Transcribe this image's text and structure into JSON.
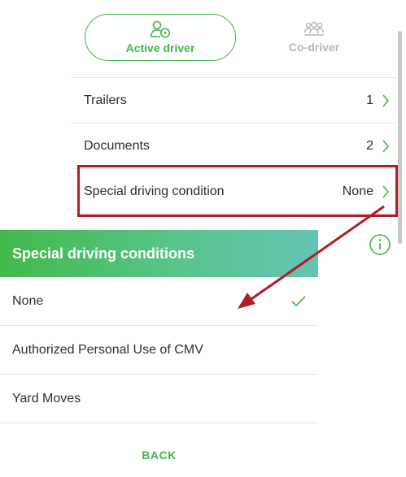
{
  "driver_toggle": {
    "active_label": "Active driver",
    "inactive_label": "Co-driver",
    "active_icon": "active-driver-icon",
    "inactive_icon": "co-driver-icon"
  },
  "settings_list": {
    "rows": [
      {
        "label": "Trailers",
        "value": "1"
      },
      {
        "label": "Documents",
        "value": "2"
      },
      {
        "label": "Special driving condition",
        "value": "None"
      }
    ]
  },
  "dialog": {
    "title": "Special driving conditions",
    "options": [
      {
        "label": "None",
        "selected": true
      },
      {
        "label": "Authorized Personal Use of CMV",
        "selected": false
      },
      {
        "label": "Yard Moves",
        "selected": false
      }
    ],
    "back_label": "BACK"
  },
  "colors": {
    "accent": "#43b649",
    "header_gradient_start": "#42b94a",
    "header_gradient_end": "#64c4b4",
    "annotation": "#b31b25",
    "inactive": "#b6b6b6"
  }
}
